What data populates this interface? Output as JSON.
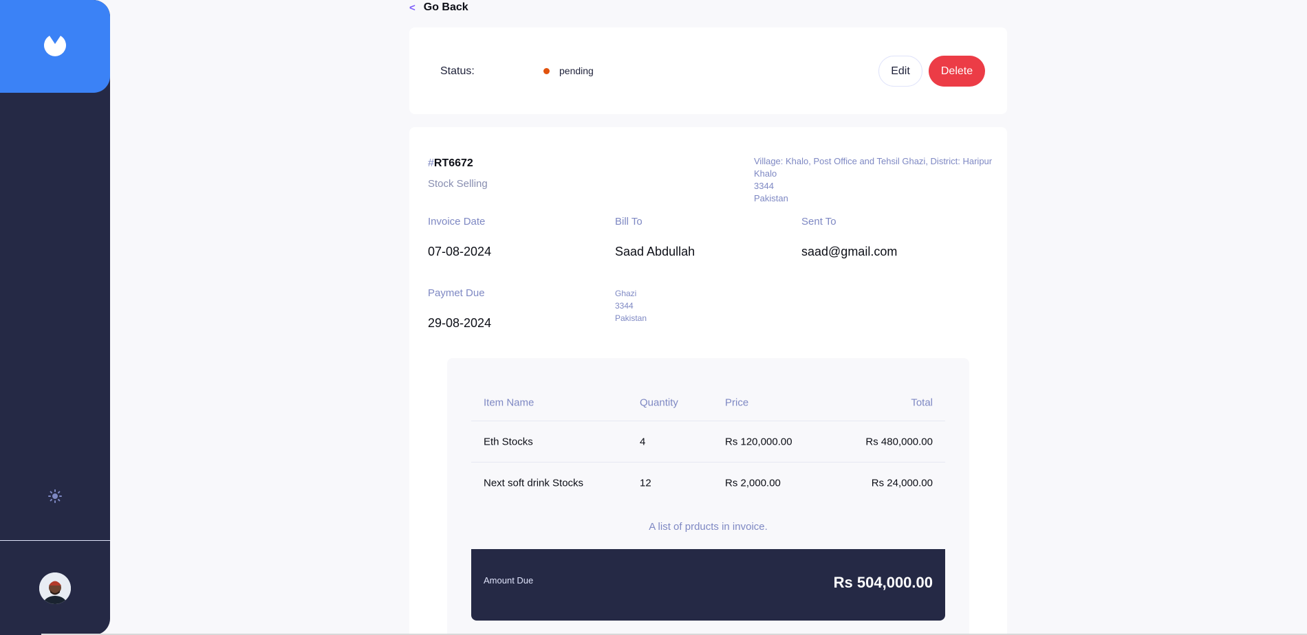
{
  "sidebar": {
    "logo_icon": "brand-logo-icon",
    "theme_icon": "sun-icon",
    "avatar_icon": "user-avatar",
    "accent_color": "#3b82f6",
    "bg_color": "#252945"
  },
  "nav": {
    "back_label": "Go Back",
    "back_chevron": "<"
  },
  "status": {
    "label": "Status:",
    "value": "pending",
    "dot_color": "#e1520d",
    "edit_label": "Edit",
    "delete_label": "Delete"
  },
  "invoice": {
    "hash": "#",
    "id": "RT6672",
    "description": "Stock Selling",
    "sender_address": {
      "street": "Village: Khalo, Post Office and Tehsil Ghazi, District: Haripur",
      "city": "Khalo",
      "post_code": "3344",
      "country": "Pakistan"
    },
    "invoice_date_label": "Invoice Date",
    "invoice_date": "07-08-2024",
    "payment_due_label": "Paymet Due",
    "payment_due": "29-08-2024",
    "bill_to_label": "Bill To",
    "client_name": "Saad Abdullah",
    "client_address": {
      "city": "Ghazi",
      "post_code": "3344",
      "country": "Pakistan"
    },
    "sent_to_label": "Sent To",
    "client_email": "saad@gmail.com"
  },
  "items": {
    "headers": {
      "name": "Item Name",
      "quantity": "Quantity",
      "price": "Price",
      "total": "Total"
    },
    "rows": [
      {
        "name": "Eth Stocks",
        "quantity": "4",
        "price": "Rs 120,000.00",
        "total": "Rs 480,000.00"
      },
      {
        "name": "Next soft drink Stocks",
        "quantity": "12",
        "price": "Rs 2,000.00",
        "total": "Rs 24,000.00"
      }
    ],
    "caption": "A list of prducts in invoice."
  },
  "amount_due": {
    "label": "Amount Due",
    "value": "Rs 504,000.00"
  }
}
